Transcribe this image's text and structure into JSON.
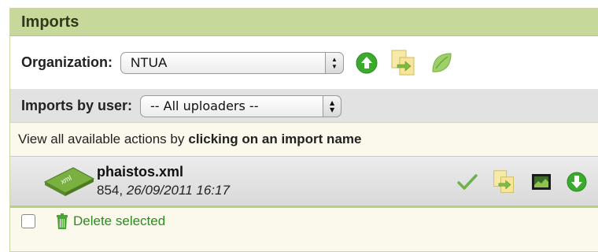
{
  "panel": {
    "title": "Imports"
  },
  "organization": {
    "label": "Organization:",
    "selected": "NTUA"
  },
  "uploaders": {
    "label": "Imports by user:",
    "selected": "-- All uploaders --"
  },
  "hint": {
    "prefix": "View all available actions by",
    "emphasis": "clicking on an import name"
  },
  "imports": [
    {
      "name": "phaistos.xml",
      "id": "854",
      "datetime": "26/09/2011 16:17",
      "badge": "xml"
    }
  ],
  "footer": {
    "delete_label": "Delete selected"
  },
  "icons": {
    "upload": "upload-arrow-icon",
    "transform": "document-transform-icon",
    "leaf": "leaf-icon",
    "check": "checkmark-icon",
    "film": "filmstrip-icon",
    "download": "download-arrow-icon",
    "trash": "trash-icon"
  },
  "colors": {
    "header": "#c6d99a",
    "accent_green": "#39a82a",
    "row_band": "#e2e2e2"
  }
}
